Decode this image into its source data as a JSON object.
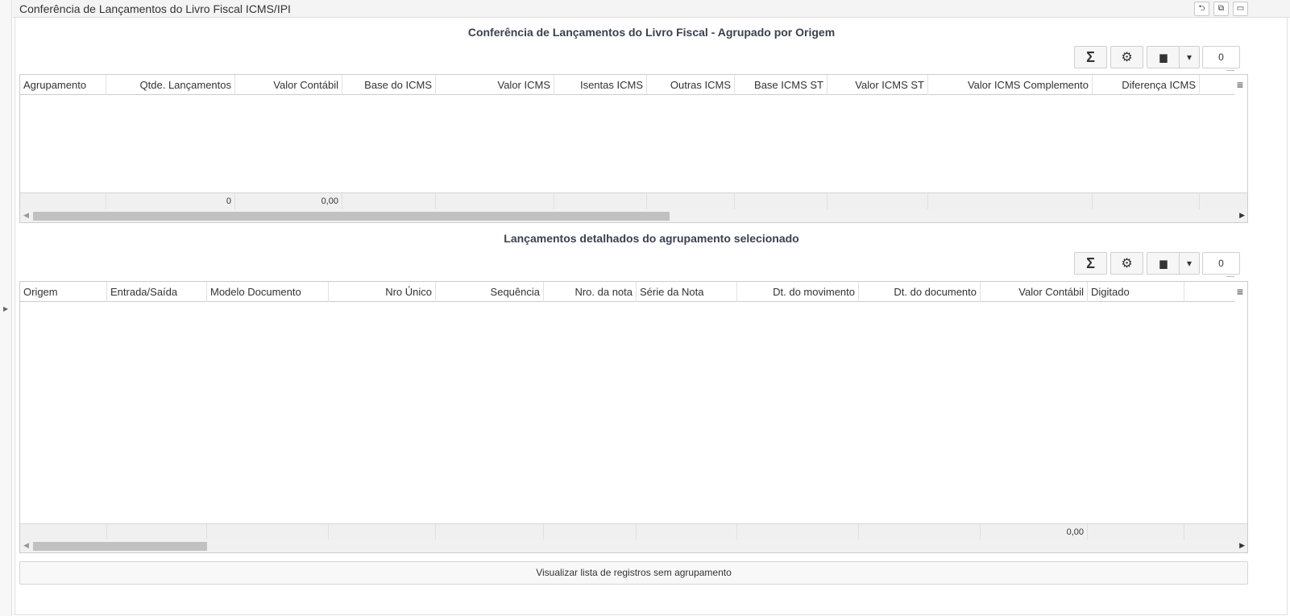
{
  "window": {
    "title": "Conferência de Lançamentos do Livro Fiscal ICMS/IPI",
    "buttons": [
      "⮌",
      "⧉",
      "▭"
    ]
  },
  "section1": {
    "title": "Conferência de Lançamentos do Livro Fiscal - Agrupado por Origem",
    "sum_icon": "Σ",
    "settings_icon": "⚙",
    "export_icon": "▆",
    "dropdown_icon": "▾",
    "count": "0",
    "columns": [
      "Agrupamento",
      "Qtde. Lançamentos",
      "Valor Contábil",
      "Base do ICMS",
      "Valor ICMS",
      "Isentas ICMS",
      "Outras ICMS",
      "Base ICMS ST",
      "Valor ICMS ST",
      "Valor ICMS Complemento",
      "Diferença ICMS"
    ],
    "footer": {
      "qtde": "0",
      "valor_contabil": "0,00"
    }
  },
  "section2": {
    "title": "Lançamentos detalhados do agrupamento selecionado",
    "sum_icon": "Σ",
    "settings_icon": "⚙",
    "export_icon": "▆",
    "dropdown_icon": "▾",
    "count": "0",
    "columns": [
      "Origem",
      "Entrada/Saída",
      "Modelo Documento",
      "Nro Único",
      "Sequência",
      "Nro. da nota",
      "Série da Nota",
      "Dt. do movimento",
      "Dt. do documento",
      "Valor Contábil",
      "Digitado"
    ],
    "footer": {
      "valor_contabil": "0,00"
    }
  },
  "actions": {
    "view_ungrouped_label": "Visualizar lista de registros sem agrupamento"
  }
}
